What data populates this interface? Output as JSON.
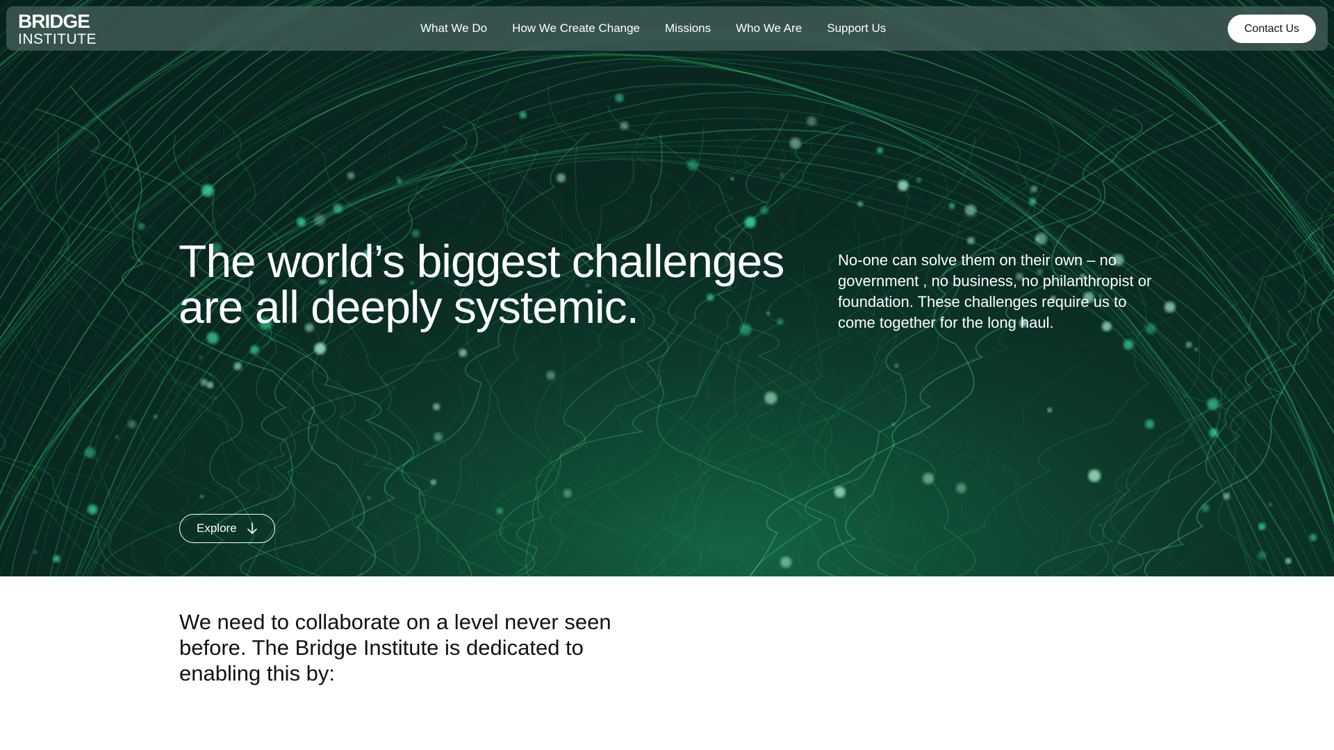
{
  "logo": {
    "line1": "BRIDGE",
    "line2": "INSTITUTE"
  },
  "nav": {
    "items": [
      {
        "label": "What We Do"
      },
      {
        "label": "How We Create Change"
      },
      {
        "label": "Missions"
      },
      {
        "label": "Who We Are"
      },
      {
        "label": "Support Us"
      }
    ],
    "contact_label": "Contact Us"
  },
  "hero": {
    "headline_line1": "The world’s biggest challenges",
    "headline_line2": "are all deeply systemic.",
    "paragraph": "No-one can solve them on their own – no government , no business, no philanthropist or foundation. These challenges require us to come together for the long haul.",
    "explore_label": "Explore",
    "explore_icon": "arrow-down-icon",
    "background_image": "green-flowing-lines-globe"
  },
  "intro": {
    "text": "We need to collaborate on a level never seen before. The Bridge Institute is dedicated to enabling this by:"
  },
  "colors": {
    "hero_bg": "#0a2a22",
    "accent_green": "#2fd47f",
    "nav_bg": "#6f8584",
    "white": "#ffffff",
    "text_dark": "#111111"
  }
}
